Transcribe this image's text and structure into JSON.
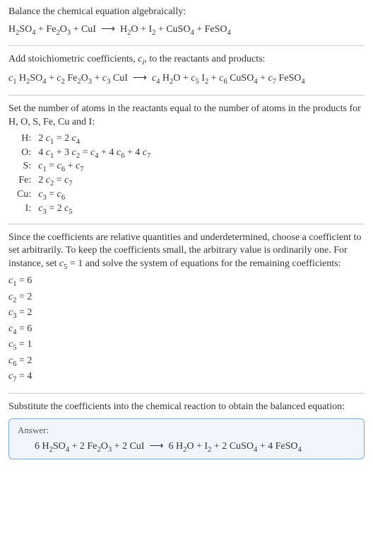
{
  "title": "Balance the chemical equation algebraically:",
  "reaction_plain": "H₂SO₄ + Fe₂O₃ + CuI ⟶ H₂O + I₂ + CuSO₄ + FeSO₄",
  "stoich_intro": "Add stoichiometric coefficients, ",
  "stoich_var": "cᵢ",
  "stoich_intro2": ", to the reactants and products:",
  "stoich_eq": "c₁ H₂SO₄ + c₂ Fe₂O₃ + c₃ CuI ⟶ c₄ H₂O + c₅ I₂ + c₆ CuSO₄ + c₇ FeSO₄",
  "atoms_intro": "Set the number of atoms in the reactants equal to the number of atoms in the products for H, O, S, Fe, Cu and I:",
  "atoms": [
    {
      "el": "H:",
      "eq": "2 c₁ = 2 c₄"
    },
    {
      "el": "O:",
      "eq": "4 c₁ + 3 c₂ = c₄ + 4 c₆ + 4 c₇"
    },
    {
      "el": "S:",
      "eq": "c₁ = c₆ + c₇"
    },
    {
      "el": "Fe:",
      "eq": "2 c₂ = c₇"
    },
    {
      "el": "Cu:",
      "eq": "c₃ = c₆"
    },
    {
      "el": "I:",
      "eq": "c₃ = 2 c₅"
    }
  ],
  "underdetermined": "Since the coefficients are relative quantities and underdetermined, choose a coefficient to set arbitrarily. To keep the coefficients small, the arbitrary value is ordinarily one. For instance, set c₅ = 1 and solve the system of equations for the remaining coefficients:",
  "coeffs": [
    "c₁ = 6",
    "c₂ = 2",
    "c₃ = 2",
    "c₄ = 6",
    "c₅ = 1",
    "c₆ = 2",
    "c₇ = 4"
  ],
  "substitute": "Substitute the coefficients into the chemical reaction to obtain the balanced equation:",
  "answer_label": "Answer:",
  "answer_eq": "6 H₂SO₄ + 2 Fe₂O₃ + 2 CuI ⟶ 6 H₂O + I₂ + 2 CuSO₄ + 4 FeSO₄"
}
